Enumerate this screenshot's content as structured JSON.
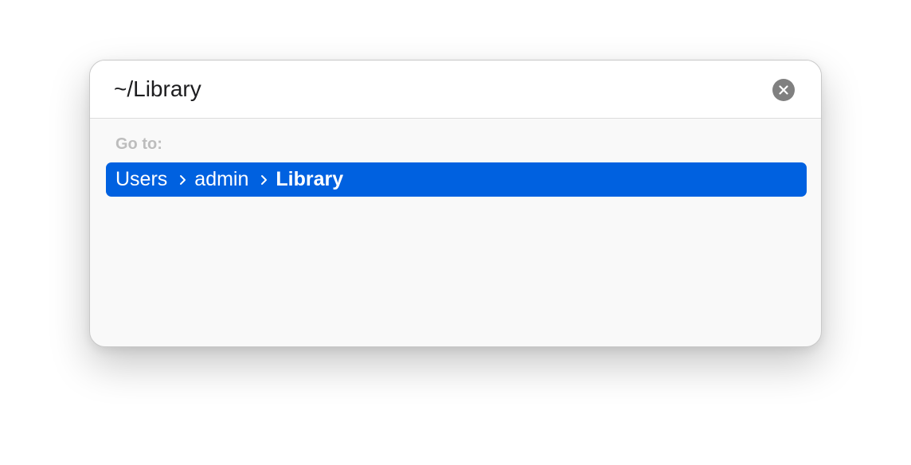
{
  "go_to_dialog": {
    "path_input": {
      "value": "~/Library"
    },
    "clear_button": {
      "icon": "close-icon"
    },
    "section_label": "Go to:",
    "results": [
      {
        "breadcrumb": [
          "Users",
          "admin",
          "Library"
        ],
        "selected": true
      }
    ]
  },
  "colors": {
    "selection": "#0061e0",
    "section_label": "#bdbdbd",
    "clear_button": "#808080"
  }
}
